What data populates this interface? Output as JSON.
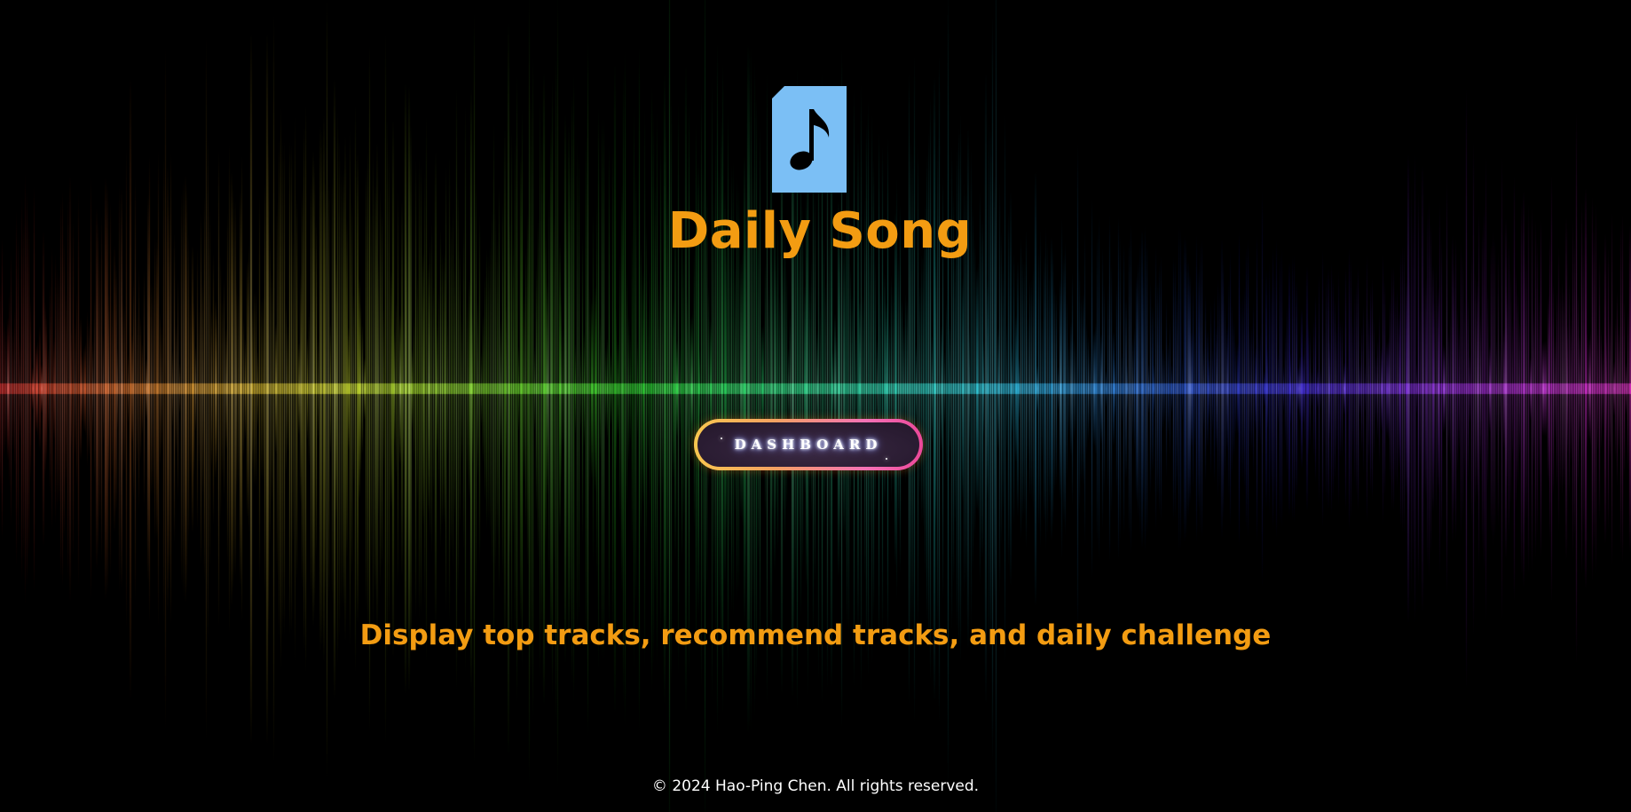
{
  "header": {
    "title": "Daily Song",
    "logo_icon": "music-file-icon"
  },
  "nav": {
    "dashboard_label": "DASHBOARD"
  },
  "main": {
    "tagline": "Display top tracks, recommend tracks, and daily challenge"
  },
  "footer": {
    "copyright": "© 2024 Hao-Ping Chen. All rights reserved."
  },
  "colors": {
    "background": "#000000",
    "title": "#f39c12",
    "logo": "#7bbff5",
    "button_border_start": "#f9c74f",
    "button_border_end": "#ec4899",
    "button_fill": "#2a1c32",
    "footer_text": "#ffffff"
  },
  "background_image": "rainbow-sound-wave"
}
